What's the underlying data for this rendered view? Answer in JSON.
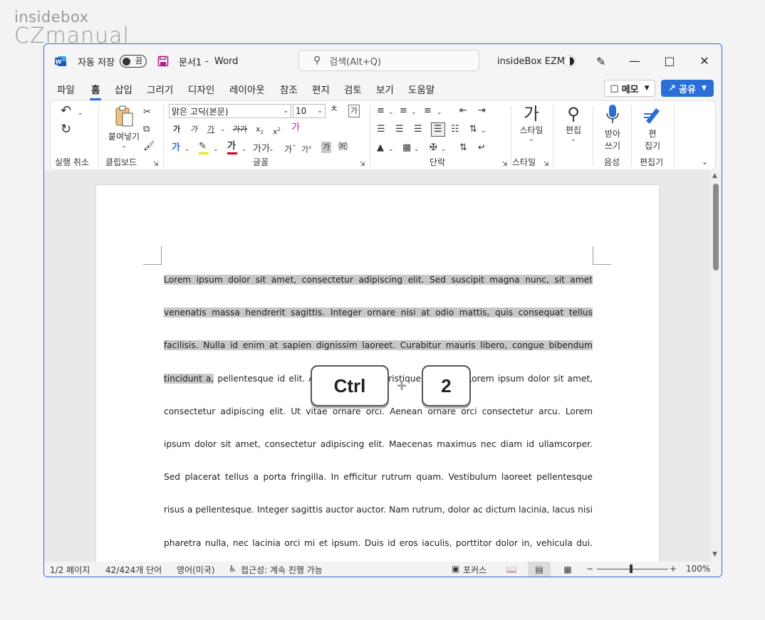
{
  "watermark": {
    "line1": "insidebox",
    "line2": "CZmanual"
  },
  "titlebar": {
    "autosave_label": "자동 저장",
    "autosave_state": "끔",
    "doc_name": "문서1",
    "separator": "-",
    "app_name": "Word",
    "search_placeholder": "검색(Alt+Q)",
    "user_name": "insideBox EZM"
  },
  "tabs": [
    "파일",
    "홈",
    "삽입",
    "그리기",
    "디자인",
    "레이아웃",
    "참조",
    "편지",
    "검토",
    "보기",
    "도움말"
  ],
  "active_tab": "홈",
  "actions": {
    "memo": "메모",
    "share": "공유"
  },
  "ribbon": {
    "groups": {
      "undo": "실행 취소",
      "clipboard": "클립보드",
      "font": "글꼴",
      "paragraph": "단락",
      "style": "스타일",
      "voice": "음성",
      "editor": "편집기"
    },
    "paste_label": "붙여넣기",
    "font_name": "맑은 고딕(본문)",
    "font_size": "10",
    "style_button": "스타일",
    "edit_button": "편집",
    "dictate_line1": "받아",
    "dictate_line2": "쓰기",
    "editor_line1": "편",
    "editor_line2": "집기"
  },
  "document": {
    "selected_text": "Lorem ipsum dolor sit amet, consectetur adipiscing elit. Sed suscipit magna nunc, sit amet venenatis massa hendrerit sagittis. Integer ornare nisi at odio mattis, quis consequat tellus facilisis. Nulla id enim at sapien dignissim laoreet. Curabitur mauris libero, congue bibendum tincidunt a,",
    "body_text": " pellentesque id elit. Aenean vehicula tristique tristique. Lorem ipsum dolor sit amet, consectetur adipiscing elit. Ut vitae ornare orci. Aenean ornare orci consectetur arcu. Lorem ipsum dolor sit amet, consectetur adipiscing elit. Maecenas maximus nec diam id ullamcorper. Sed placerat tellus a porta fringilla. In efficitur rutrum quam. Vestibulum laoreet pellentesque risus a pellentesque. Integer sagittis auctor auctor. Nam rutrum, dolor ac dictum lacinia, lacus nisi pharetra nulla, nec lacinia orci mi et ipsum. Duis id eros iaculis, porttitor dolor in, vehicula dui. Nullam ut hendrerit"
  },
  "shortcut": {
    "key1": "Ctrl",
    "plus": "+",
    "key2": "2"
  },
  "statusbar": {
    "page": "1/2 페이지",
    "words": "42/424개 단어",
    "language": "영어(미국)",
    "accessibility": "접근성: 계속 진행 가능",
    "focus": "포커스",
    "zoom_minus": "−",
    "zoom_plus": "+",
    "zoom": "100%",
    "zoom_level_fraction": 0.5
  },
  "colors": {
    "accent": "#2a6fd6",
    "selection": "#c8c8c8",
    "highlight_yellow": "#f5e400",
    "font_red": "#d0021b"
  },
  "icons": [
    "word-icon",
    "save-icon",
    "search-icon",
    "mic-icon",
    "pen-icon",
    "minimize-icon",
    "maximize-icon",
    "close-icon"
  ]
}
